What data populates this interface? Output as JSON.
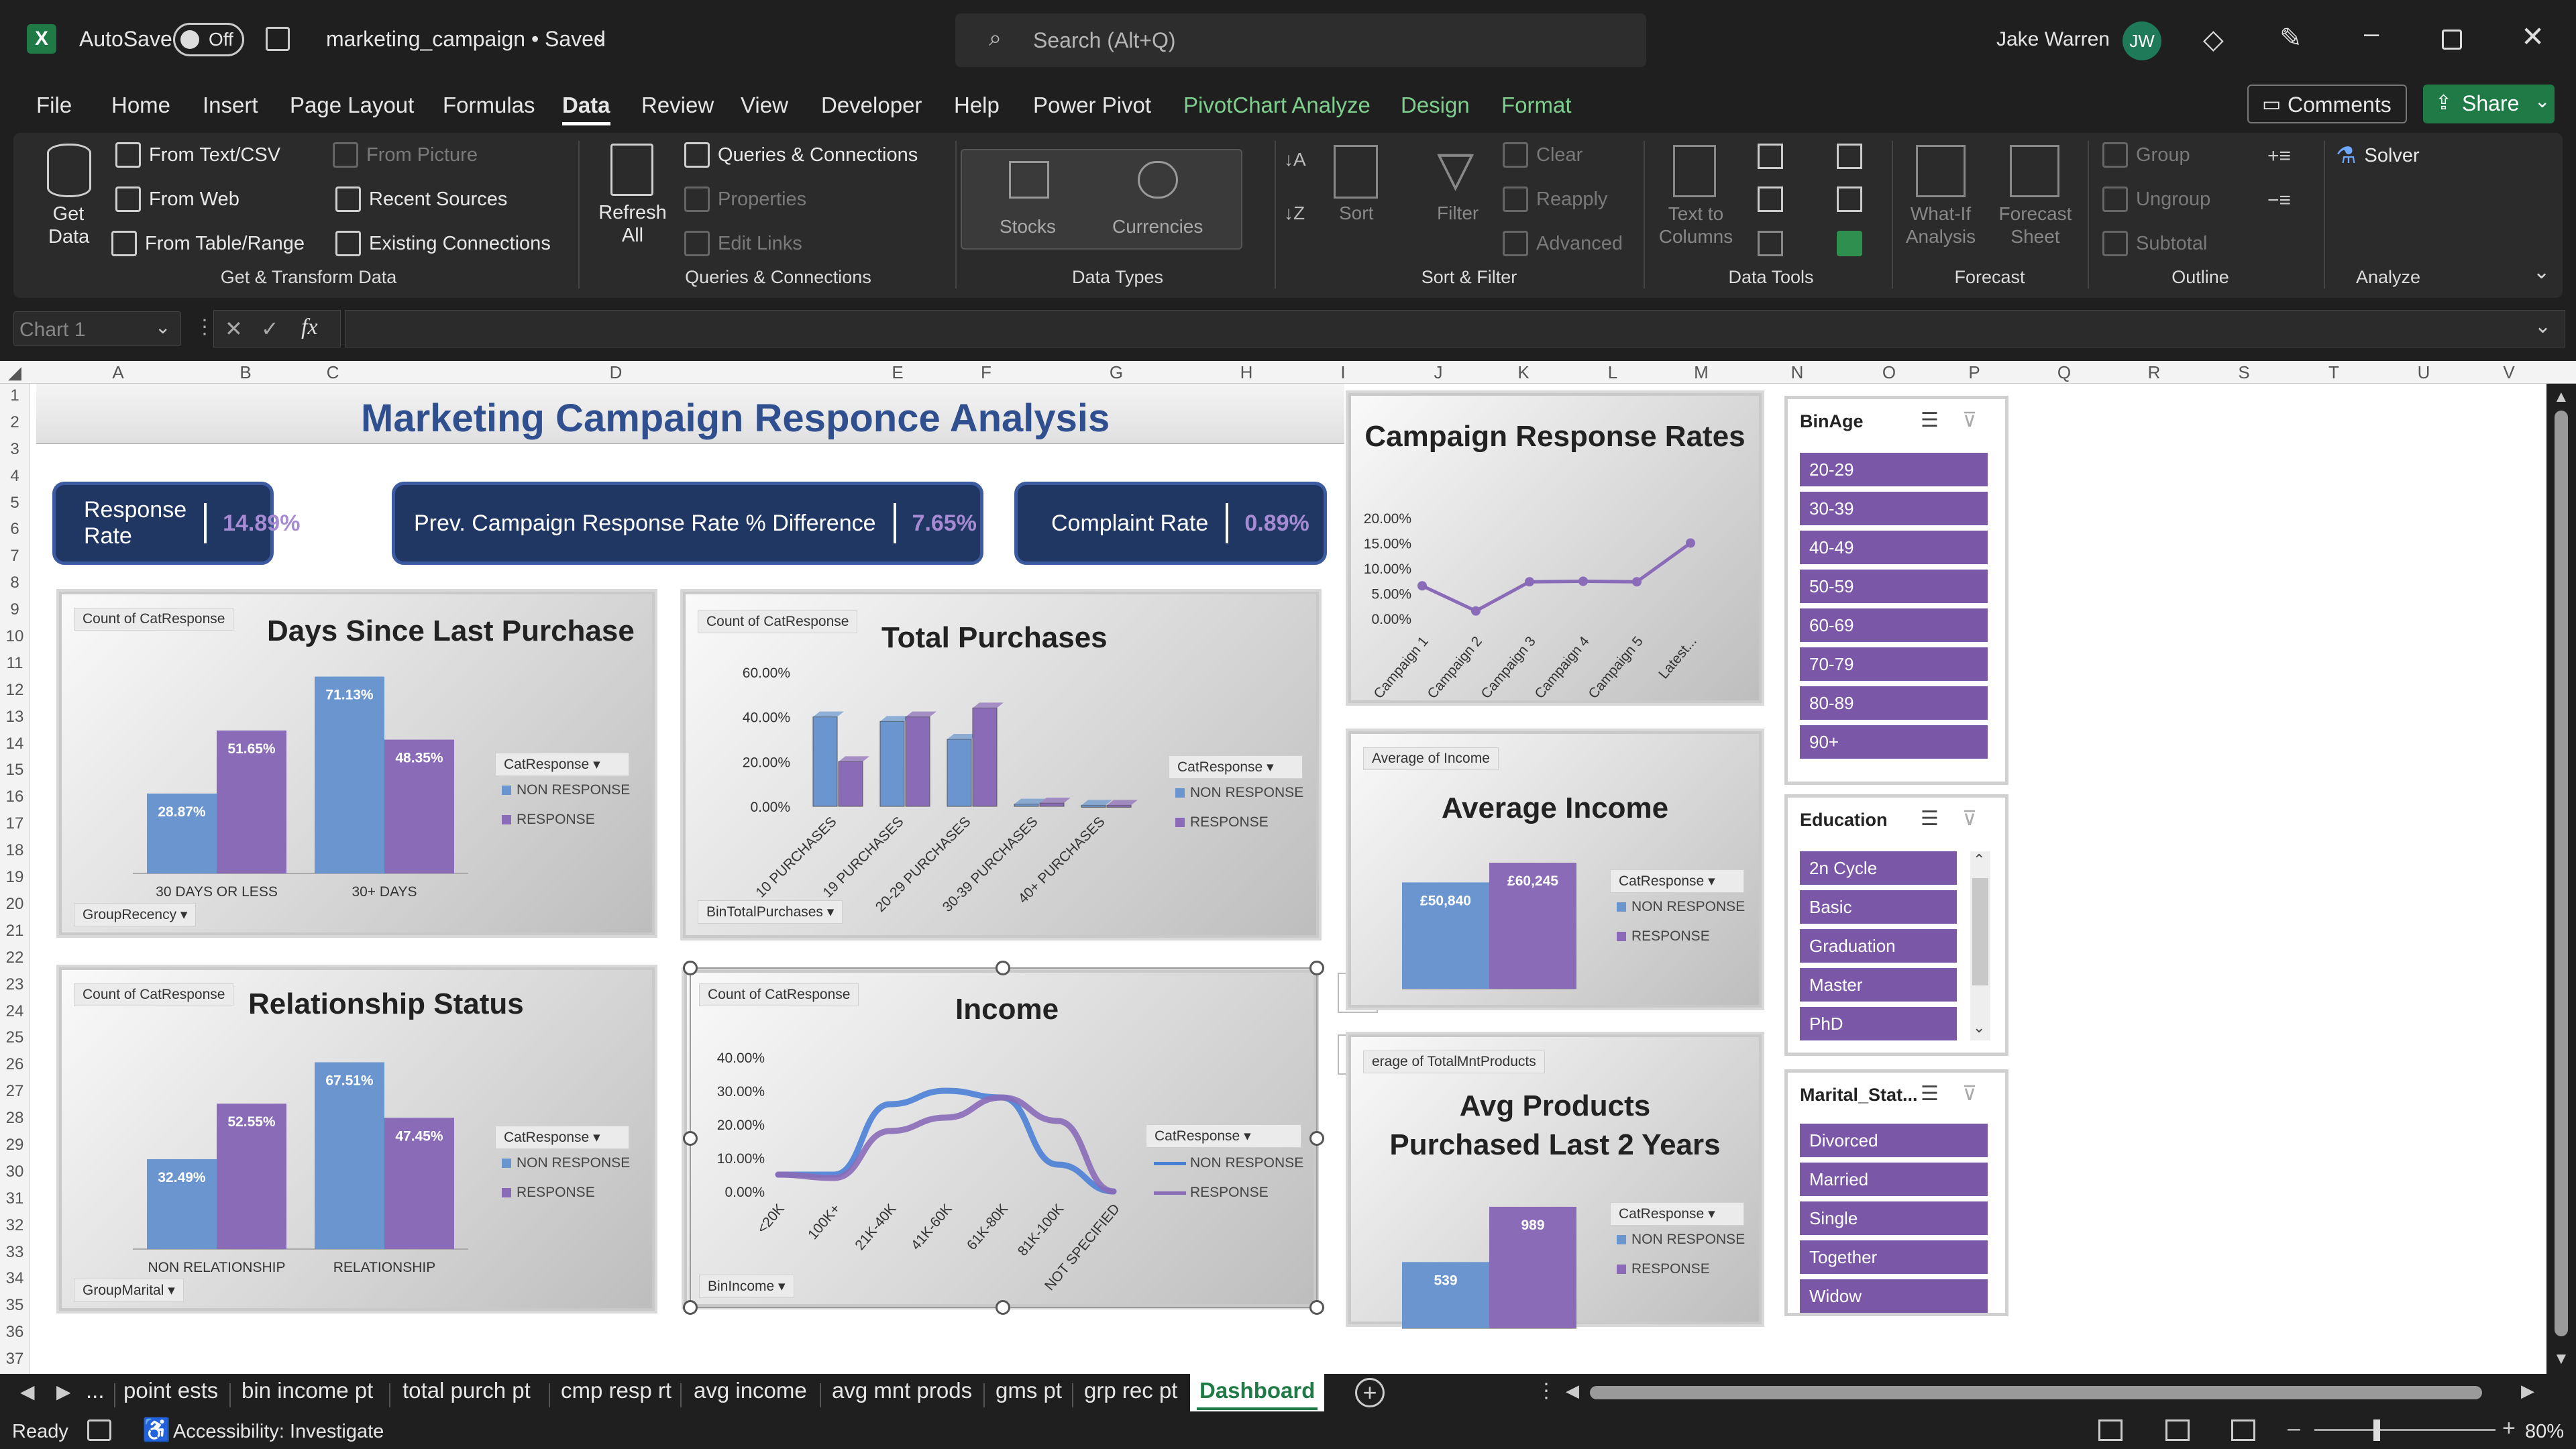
{
  "titlebar": {
    "autosave": "AutoSave",
    "autosave_state": "Off",
    "filename": "marketing_campaign • Saved",
    "search": "Search (Alt+Q)",
    "user": "Jake Warren",
    "initials": "JW"
  },
  "menu": [
    "File",
    "Home",
    "Insert",
    "Page Layout",
    "Formulas",
    "Data",
    "Review",
    "View",
    "Developer",
    "Help",
    "Power Pivot",
    "PivotChart Analyze",
    "Design",
    "Format"
  ],
  "menu_right": {
    "comments": "Comments",
    "share": "Share"
  },
  "ribbon": {
    "get_data": "Get Data",
    "from_text": "From Text/CSV",
    "from_web": "From Web",
    "from_table": "From Table/Range",
    "from_picture": "From Picture",
    "recent": "Recent Sources",
    "existing": "Existing Connections",
    "grp_get": "Get & Transform Data",
    "refresh": "Refresh All",
    "queries": "Queries & Connections",
    "properties": "Properties",
    "edit_links": "Edit Links",
    "grp_queries": "Queries & Connections",
    "stocks": "Stocks",
    "currencies": "Currencies",
    "grp_types": "Data Types",
    "sort": "Sort",
    "filter": "Filter",
    "clear": "Clear",
    "reapply": "Reapply",
    "advanced": "Advanced",
    "grp_sort": "Sort & Filter",
    "text_to_columns": "Text to Columns",
    "grp_tools": "Data Tools",
    "whatif": "What-If Analysis",
    "forecast_sheet": "Forecast Sheet",
    "grp_forecast": "Forecast",
    "group": "Group",
    "ungroup": "Ungroup",
    "subtotal": "Subtotal",
    "grp_outline": "Outline",
    "solver": "Solver",
    "grp_analyze": "Analyze"
  },
  "formula_bar": {
    "name_box": "Chart 1",
    "fx": "fx"
  },
  "columns": [
    "A",
    "B",
    "C",
    "D",
    "E",
    "F",
    "G",
    "H",
    "I",
    "J",
    "K",
    "L",
    "M",
    "N",
    "O",
    "P",
    "Q",
    "R",
    "S",
    "T",
    "U",
    "V"
  ],
  "rows": [
    "1",
    "2",
    "3",
    "4",
    "5",
    "6",
    "7",
    "8",
    "9",
    "10",
    "11",
    "12",
    "13",
    "14",
    "15",
    "16",
    "17",
    "18",
    "19",
    "20",
    "21",
    "22",
    "23",
    "24",
    "25",
    "26",
    "27",
    "28",
    "29",
    "30",
    "31",
    "32",
    "33",
    "34",
    "35",
    "36",
    "37"
  ],
  "dashboard": {
    "title": "Marketing Campaign Responce Analysis",
    "kpi": [
      {
        "label": "Response Rate",
        "value": "14.89%"
      },
      {
        "label": "Prev. Campaign Response Rate % Difference",
        "value": "7.65%"
      },
      {
        "label": "Complaint Rate",
        "value": "0.89%"
      }
    ],
    "legend_title": "CatResponse",
    "legend_non": "NON RESPONSE",
    "legend_resp": "RESPONSE",
    "count_field": "Count of CatResponse"
  },
  "colors": {
    "non_response": "#6a95cf",
    "response": "#8a6bb8",
    "kpi_bg": "#203764",
    "slicer_item": "#7b57a7",
    "accent_green": "#1f7a45"
  },
  "chart_data": [
    {
      "id": "days",
      "type": "bar",
      "title": "Days Since Last Purchase",
      "field_label": "Count of CatResponse",
      "axis_field": "GroupRecency",
      "categories": [
        "30 DAYS OR LESS",
        "30+ DAYS"
      ],
      "series": [
        {
          "name": "NON RESPONSE",
          "values": [
            28.87,
            71.13
          ]
        },
        {
          "name": "RESPONSE",
          "values": [
            51.65,
            48.35
          ]
        }
      ],
      "labels": [
        [
          "28.87%",
          "71.13%"
        ],
        [
          "51.65%",
          "48.35%"
        ]
      ],
      "ylim": [
        0,
        80
      ]
    },
    {
      "id": "purch",
      "type": "bar",
      "title": "Total Purchases",
      "field_label": "Count of CatResponse",
      "axis_field": "BinTotalPurchases",
      "categories": [
        "10 PURCHASES",
        "19 PURCHASES",
        "20-29 PURCHASES",
        "30-39 PURCHASES",
        "40+ PURCHASES"
      ],
      "series": [
        {
          "name": "NON RESPONSE",
          "values": [
            40,
            38,
            30,
            1,
            0.5
          ]
        },
        {
          "name": "RESPONSE",
          "values": [
            20,
            40,
            44,
            1.5,
            0.5
          ]
        }
      ],
      "yticks": [
        "60.00%",
        "40.00%",
        "20.00%",
        "0.00%"
      ],
      "ylim": [
        0,
        60
      ]
    },
    {
      "id": "rel",
      "type": "bar",
      "title": "Relationship Status",
      "field_label": "Count of CatResponse",
      "axis_field": "GroupMarital",
      "categories": [
        "NON RELATIONSHIP",
        "RELATIONSHIP"
      ],
      "series": [
        {
          "name": "NON RESPONSE",
          "values": [
            32.49,
            67.51
          ]
        },
        {
          "name": "RESPONSE",
          "values": [
            52.55,
            47.45
          ]
        }
      ],
      "labels": [
        [
          "32.49%",
          "67.51%"
        ],
        [
          "52.55%",
          "47.45%"
        ]
      ],
      "ylim": [
        0,
        80
      ]
    },
    {
      "id": "income",
      "type": "line",
      "title": "Income",
      "field_label": "Count of CatResponse",
      "axis_field": "BinIncome",
      "categories": [
        "<20K",
        "100K+",
        "21K-40K",
        "41K-60K",
        "61K-80K",
        "81K-100K",
        "NOT SPECIFIED"
      ],
      "series": [
        {
          "name": "NON RESPONSE",
          "values": [
            5,
            5,
            26,
            30,
            28,
            8,
            0
          ]
        },
        {
          "name": "RESPONSE",
          "values": [
            5,
            4,
            18,
            22,
            28,
            21,
            0
          ]
        }
      ],
      "yticks": [
        "40.00%",
        "30.00%",
        "20.00%",
        "10.00%",
        "0.00%"
      ],
      "ylim": [
        0,
        40
      ]
    },
    {
      "id": "cmp",
      "type": "line",
      "title": "Campaign Response Rates",
      "categories": [
        "Campaign 1",
        "Campaign 2",
        "Campaign 3",
        "Campaign 4",
        "Campaign 5",
        "Latest..."
      ],
      "series": [
        {
          "values": [
            6.5,
            1.5,
            7.3,
            7.4,
            7.3,
            15
          ]
        }
      ],
      "yticks": [
        "20.00%",
        "15.00%",
        "10.00%",
        "5.00%",
        "0.00%"
      ],
      "ylim": [
        0,
        20
      ]
    },
    {
      "id": "avginc",
      "type": "bar",
      "title": "Average Income",
      "field_label": "Average of Income",
      "categories": [
        ""
      ],
      "series": [
        {
          "name": "NON RESPONSE",
          "values": [
            50840
          ]
        },
        {
          "name": "RESPONSE",
          "values": [
            60245
          ]
        }
      ],
      "labels": [
        [
          "£50,840"
        ],
        [
          "£60,245"
        ]
      ],
      "ylim": [
        0,
        75000
      ]
    },
    {
      "id": "avgprod",
      "type": "bar",
      "title": "Avg Products Purchased Last 2 Years",
      "field_label": "erage of TotalMntProducts",
      "categories": [
        ""
      ],
      "series": [
        {
          "name": "NON RESPONSE",
          "values": [
            539
          ]
        },
        {
          "name": "RESPONSE",
          "values": [
            989
          ]
        }
      ],
      "labels": [
        [
          "539"
        ],
        [
          "989"
        ]
      ],
      "ylim": [
        0,
        1300
      ]
    }
  ],
  "slicers": {
    "binage": {
      "title": "BinAge",
      "items": [
        "20-29",
        "30-39",
        "40-49",
        "50-59",
        "60-69",
        "70-79",
        "80-89",
        "90+"
      ]
    },
    "education": {
      "title": "Education",
      "items": [
        "2n Cycle",
        "Basic",
        "Graduation",
        "Master",
        "PhD"
      ]
    },
    "marital": {
      "title": "Marital_Stat...",
      "items": [
        "Divorced",
        "Married",
        "Single",
        "Together",
        "Widow"
      ]
    }
  },
  "sheet_tabs": [
    "...",
    "point ests",
    "bin income pt",
    "total purch pt",
    "cmp resp rt",
    "avg income",
    "avg mnt prods",
    "gms pt",
    "grp rec pt",
    "Dashboard"
  ],
  "status": {
    "ready": "Ready",
    "accessibility": "Accessibility: Investigate",
    "zoom": "80%"
  }
}
